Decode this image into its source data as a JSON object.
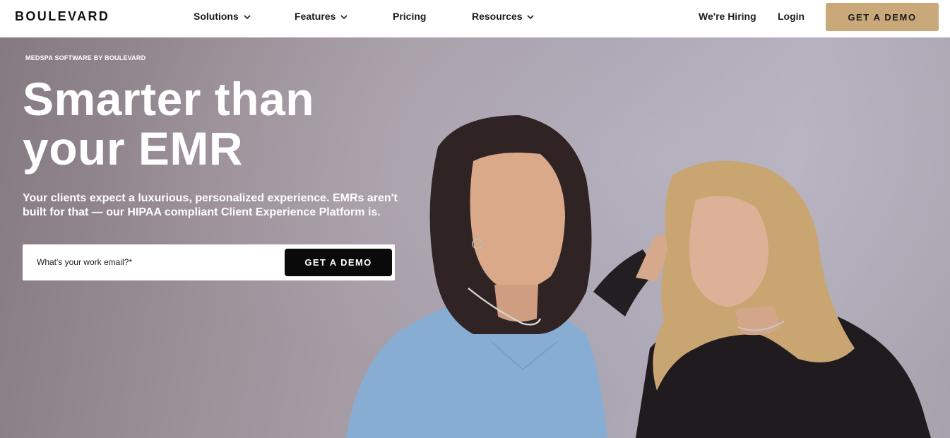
{
  "brand": {
    "logo": "BOULEVARD"
  },
  "nav": {
    "items": [
      {
        "label": "Solutions",
        "has_dropdown": true
      },
      {
        "label": "Features",
        "has_dropdown": true
      },
      {
        "label": "Pricing",
        "has_dropdown": false
      },
      {
        "label": "Resources",
        "has_dropdown": true
      }
    ],
    "hiring": "We're Hiring",
    "login": "Login",
    "cta": "GET A DEMO"
  },
  "hero": {
    "eyebrow": "MEDSPA SOFTWARE BY BOULEVARD",
    "headline_line1": "Smarter than",
    "headline_line2": "your EMR",
    "subcopy_line1": "Your clients expect a luxurious, personalized experience. EMRs aren't",
    "subcopy_line2": "built for that — our HIPAA compliant Client Experience Platform is.",
    "email_placeholder": "What's your work email?*",
    "email_value": "",
    "cta": "GET A DEMO"
  },
  "colors": {
    "accent_gold": "#c9a97a",
    "cta_dark": "#0a0a0a",
    "hero_bg": "#a9a3b0"
  }
}
